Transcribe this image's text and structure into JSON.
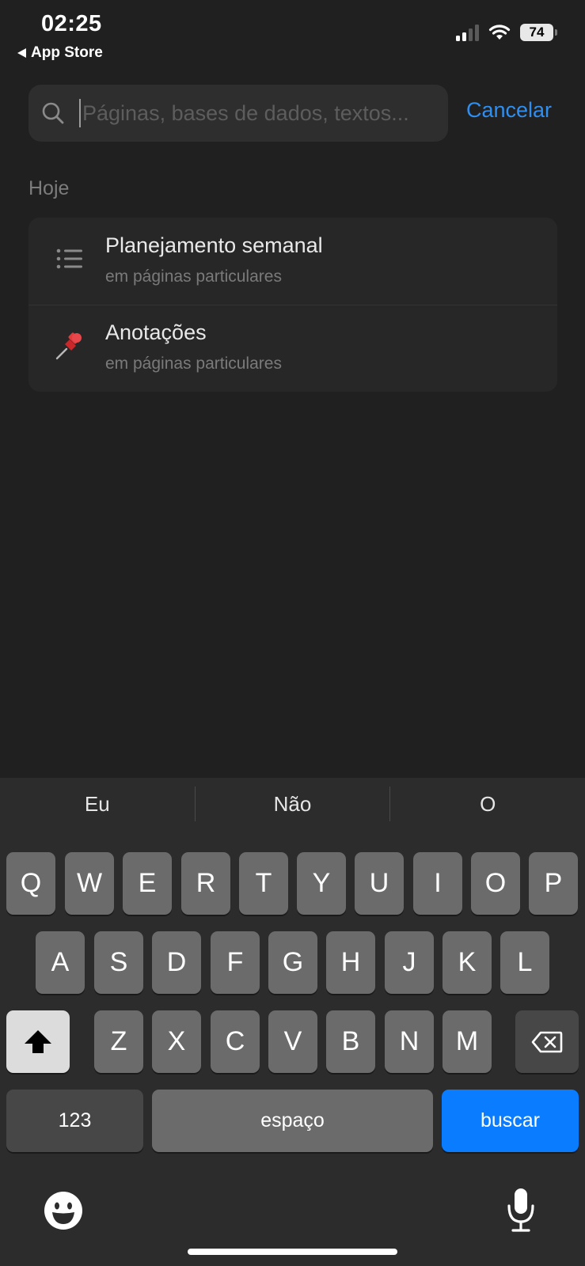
{
  "status_bar": {
    "time": "02:25",
    "back_app": "App Store",
    "battery": "74"
  },
  "search": {
    "placeholder": "Páginas, bases de dados, textos...",
    "cancel_label": "Cancelar"
  },
  "section": {
    "title": "Hoje"
  },
  "results": [
    {
      "title": "Planejamento semanal",
      "subtitle": "em páginas particulares",
      "icon": "list-icon"
    },
    {
      "title": "Anotações",
      "subtitle": "em páginas particulares",
      "icon": "pushpin-icon"
    }
  ],
  "keyboard": {
    "suggestions": [
      "Eu",
      "Não",
      "O"
    ],
    "row1": [
      "Q",
      "W",
      "E",
      "R",
      "T",
      "Y",
      "U",
      "I",
      "O",
      "P"
    ],
    "row2": [
      "A",
      "S",
      "D",
      "F",
      "G",
      "H",
      "J",
      "K",
      "L"
    ],
    "row3": [
      "Z",
      "X",
      "C",
      "V",
      "B",
      "N",
      "M"
    ],
    "numbers_label": "123",
    "space_label": "espaço",
    "go_label": "buscar"
  },
  "colors": {
    "accent": "#2f8ff0",
    "go_key": "#0a7cff",
    "background": "#202020"
  }
}
